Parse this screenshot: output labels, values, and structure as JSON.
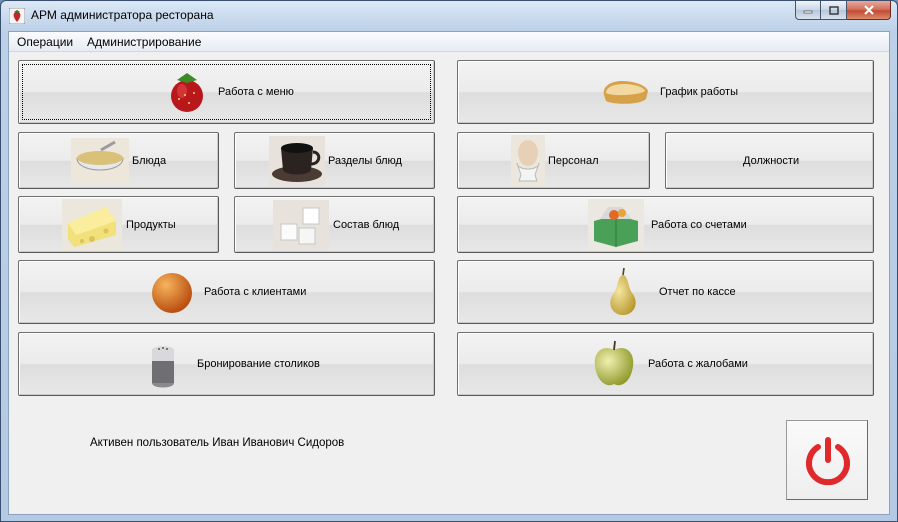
{
  "window": {
    "title": "АРМ администратора ресторана"
  },
  "menubar": {
    "items": [
      {
        "label": "Операции"
      },
      {
        "label": "Администрирование"
      }
    ]
  },
  "buttons": {
    "menu": "Работа с меню",
    "schedule": "График работы",
    "dishes": "Блюда",
    "dish_sections": "Разделы блюд",
    "staff": "Персонал",
    "positions": "Должности",
    "products": "Продукты",
    "dish_composition": "Состав блюд",
    "bills": "Работа со счетами",
    "clients": "Работа с клиентами",
    "cash_report": "Отчет по кассе",
    "booking": "Бронирование столиков",
    "complaints": "Работа с жалобами"
  },
  "status": {
    "text": "Активен пользователь Иван Иванович Сидоров"
  },
  "colors": {
    "exit_accent": "#e0292b",
    "title_bar": "#b4c9e3"
  }
}
